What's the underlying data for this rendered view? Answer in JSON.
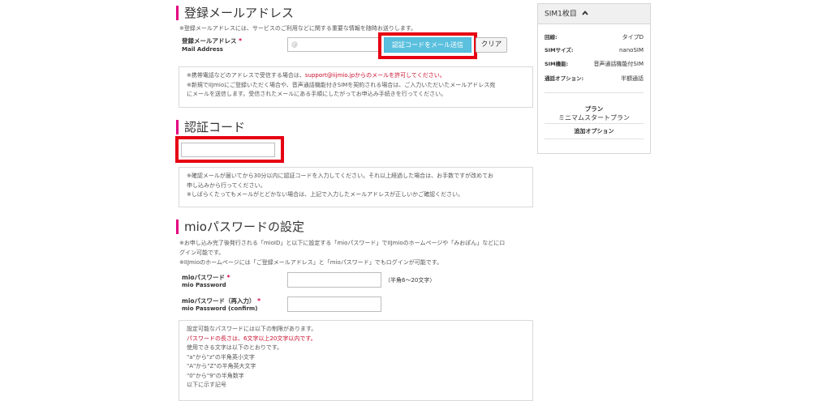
{
  "email_section": {
    "title": "登録メールアドレス",
    "desc": "※登録メールアドレスには、サービスのご利用などに関する重要な情報を随時お送りします。",
    "field_label": "登録メールアドレス",
    "required_mark": "*",
    "field_sublabel": "Mail Address",
    "input_placeholder": "@",
    "send_button": "認証コードをメール送信",
    "clear_button": "クリア",
    "info_line1_pre": "※携帯電話などのアドレスで受信する場合は、",
    "info_line1_red": "support@iijmio.jpからのメールを許可してください。",
    "info_line2": "※新規でIIJmioにご登録いただく場合や、音声通話機能付きSIMを契約される場合は、ご入力いただいたメールアドレス宛",
    "info_line3": "にメールを送信します。受信されたメールにある手順にしたがってお申込み手続きを行ってください。"
  },
  "auth_section": {
    "title": "認証コード",
    "input_value": "",
    "info_line1": "※確認メールが届いてから30分以内に認証コードを入力してください。それ以上経過した場合は、お手数ですが改めてお",
    "info_line2": "申し込みから行ってください。",
    "info_line3": "※しばらくたってもメールがとどかない場合は、上記で入力したメールアドレスが正しいかご確認ください。"
  },
  "password_section": {
    "title": "mioパスワードの設定",
    "desc1": "※お申し込み完了後発行される「mioID」と以下に設定する「mioパスワード」でIIJmioのホームページや「みおぽん」などにロ",
    "desc2": "グイン可能です。",
    "desc3": "※IIJmioのホームページには「ご登録メールアドレス」と「mioパスワード」でもログインが可能です。",
    "pw_label": "mioパスワード",
    "pw_required": "*",
    "pw_sublabel": "mio Password",
    "pw_hint": "（半角6～20文字）",
    "pw2_label": "mioパスワード（再入力）",
    "pw2_required": "*",
    "pw2_sublabel": "mio Password (confirm)",
    "rules": [
      "設定可能なパスワードには以下の制限があります。",
      "パスワードの長さは、6文字以上20文字以内です。",
      "使用できる文字は以下のとおりです。",
      "\"a\"から\"z\"の半角英小文字",
      "\"A\"から\"Z\"の半角英大文字",
      "\"0\"から\"9\"の半角数字",
      "以下に示す記号"
    ]
  },
  "sidebar": {
    "title": "SIM1枚目",
    "rows": [
      {
        "key": "回線:",
        "value": "タイプD"
      },
      {
        "key": "SIMサイズ:",
        "value": "nanoSIM"
      },
      {
        "key": "SIM機能:",
        "value": "音声通話機能付SIM"
      },
      {
        "key": "通話オプション:",
        "value": "半額通話"
      }
    ],
    "plan_label": "プラン",
    "plan_value": "ミニマムスタートプラン",
    "option_label": "追加オプション"
  },
  "colors": {
    "accent_pink": "#e4007f",
    "highlight_red": "#e60012",
    "button_blue": "#5bc0de",
    "warning_red": "#c8102e"
  }
}
